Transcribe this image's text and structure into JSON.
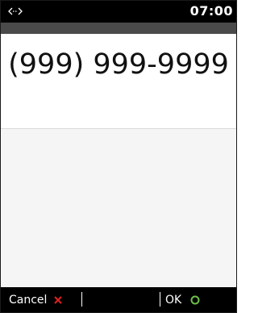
{
  "status_bar": {
    "time": "07:00",
    "left_icon": "link-arrows-icon"
  },
  "entry": {
    "phone_number": "(999) 999-9999"
  },
  "softkeys": {
    "cancel_label": "Cancel",
    "cancel_icon": "close-x-icon",
    "ok_label": "OK",
    "ok_icon": "circle-ok-icon"
  },
  "colors": {
    "status_bar_bg": "#000000",
    "subheader_bg": "#4a4a4a",
    "cancel_icon_color": "#e02020",
    "ok_icon_color": "#6cc04a"
  }
}
